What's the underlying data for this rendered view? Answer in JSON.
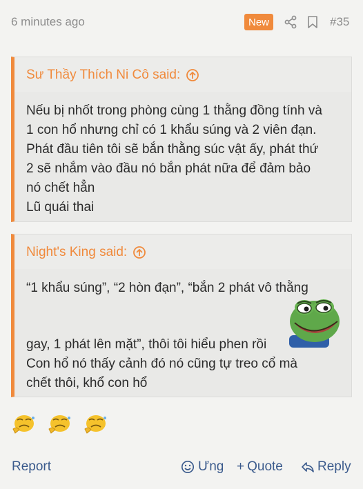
{
  "post": {
    "time": "6 minutes ago",
    "badge": "New",
    "number": "#35"
  },
  "quotes": [
    {
      "author": "Sư Thầy Thích Ni Cô said:",
      "lines": [
        "Nếu bị nhốt trong phòng cùng 1 thằng đồng tính và",
        "1 con hổ nhưng chỉ có 1 khẩu súng và 2 viên đạn.",
        "Phát đầu tiên tôi sẽ bắn thằng súc vật ấy, phát thứ",
        "2 sẽ nhắm vào đầu nó bắn phát nữa để đảm bảo",
        "nó chết hẳn",
        "Lũ quái thai"
      ]
    },
    {
      "author": "Night's King said:",
      "lines": [
        "“1 khẩu súng”, “2 hòn đạn”, “bắn 2 phát vô thằng",
        "gay, 1 phát lên mặt”, thôi tôi hiểu phen rồi",
        "Con hổ nó thấy cảnh đó nó cũng tự treo cổ mà",
        "chết thôi, khổ con hổ"
      ],
      "sticker": "pepe-smile-sticker"
    }
  ],
  "reactions": {
    "icons": [
      "sad-face-icon",
      "sad-face-icon",
      "sad-face-icon"
    ]
  },
  "footer": {
    "report": "Report",
    "ung": "Ưng",
    "quote": "Quote",
    "reply": "Reply"
  },
  "colors": {
    "accent": "#f08a3c",
    "link": "#3a5a8c",
    "background": "#f3f3f1",
    "quote_background": "#e9e9e7"
  }
}
